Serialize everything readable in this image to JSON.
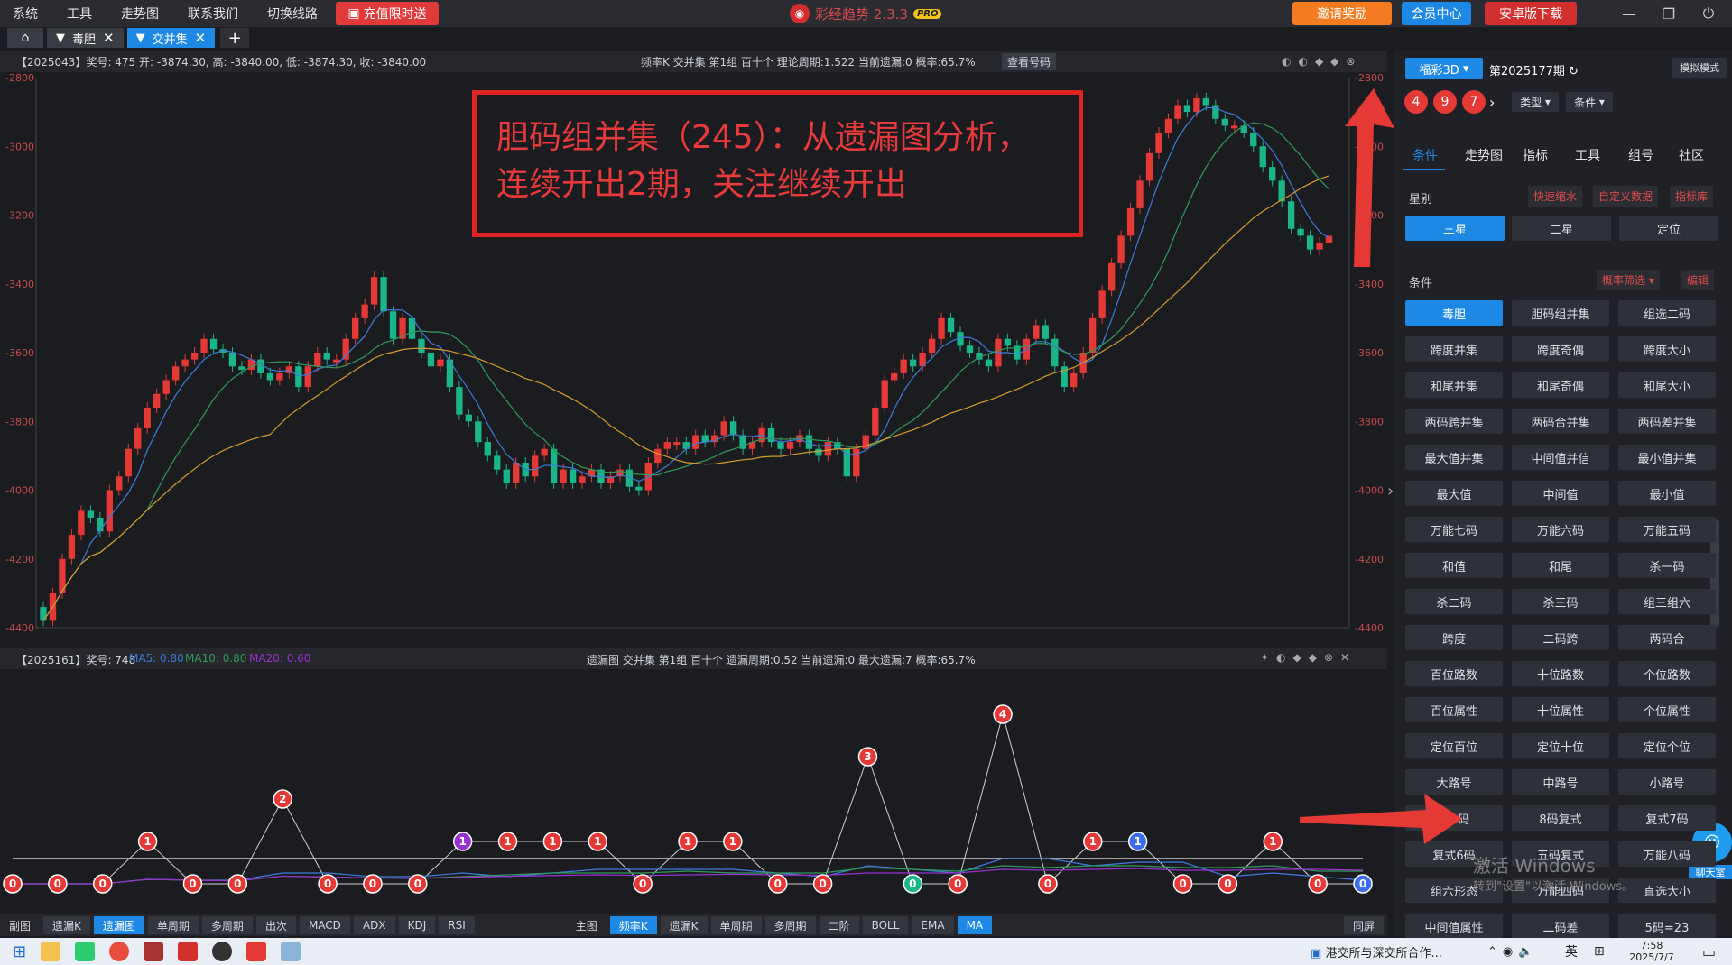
{
  "menubar": {
    "items": [
      "系统",
      "工具",
      "走势图",
      "联系我们",
      "切换线路"
    ],
    "promo": "充值限时送",
    "app_title": "彩经趋势 2.3.3",
    "pro_badge": "PRO",
    "invite": "邀请奖励",
    "member": "会员中心",
    "android": "安卓版下载"
  },
  "tabs": {
    "items": [
      {
        "label": "毒胆",
        "active": false
      },
      {
        "label": "交并集",
        "active": true
      }
    ]
  },
  "main_chart": {
    "info_left": "【2025043】奖号: 475  开: -3874.30, 高: -3840.00, 低: -3874.30, 收: -3840.00",
    "info_center": "频率K  交并集  第1组  百十个  理论周期:1.522  当前遗漏:0  概率:65.7%",
    "view_button": "查看号码",
    "y_ticks": [
      "-2800",
      "-3000",
      "-3200",
      "-3400",
      "-3600",
      "-3800",
      "-4000",
      "-4200",
      "-4400"
    ]
  },
  "sub_chart": {
    "info_left": "【2025161】奖号: 748",
    "ma5": "MA5: 0.80",
    "ma10": "MA10: 0.80",
    "ma20": "MA20: 0.60",
    "info_center": "遗漏图  交并集  第1组  百十个  遗漏周期:0.52  当前遗漏:0  最大遗漏:7  概率:65.7%"
  },
  "annotation": {
    "line1": "胆码组并集（245）：从遗漏图分析，",
    "line2": "连续开出2期，关注继续开出"
  },
  "bottombar": {
    "left": [
      "副图",
      "遗漏K",
      "遗漏图",
      "单周期",
      "多周期",
      "出次",
      "MACD",
      "ADX",
      "KDJ",
      "RSI"
    ],
    "center": [
      "主图",
      "频率K",
      "遗漏K",
      "单周期",
      "多周期",
      "二阶",
      "BOLL",
      "EMA",
      "MA"
    ],
    "right": "同屏"
  },
  "right_panel": {
    "lottery": "福彩3D",
    "period": "第2025177期",
    "mode": "模拟模式",
    "balls": [
      "4",
      "9",
      "7"
    ],
    "type_select": "类型",
    "cond_select": "条件",
    "tabs": [
      "条件",
      "走势图",
      "指标",
      "工具",
      "组号",
      "社区"
    ],
    "star_label": "星别",
    "quick_shrink": "快速缩水",
    "custom_data": "自定义数据",
    "indicator_lib": "指标库",
    "stars": [
      "三星",
      "二星",
      "定位"
    ],
    "cond_label": "条件",
    "prob_filter": "概率筛选",
    "edit": "编辑",
    "conditions": [
      "毒胆",
      "胆码组并集",
      "组选二码",
      "跨度并集",
      "跨度奇偶",
      "跨度大小",
      "和尾并集",
      "和尾奇偶",
      "和尾大小",
      "两码跨并集",
      "两码合并集",
      "两码差并集",
      "最大值并集",
      "中间值并信",
      "最小值并集",
      "最大值",
      "中间值",
      "最小值",
      "万能七码",
      "万能六码",
      "万能五码",
      "和值",
      "和尾",
      "杀一码",
      "杀二码",
      "杀三码",
      "组三组六",
      "跨度",
      "二码跨",
      "两码合",
      "百位路数",
      "十位路数",
      "个位路数",
      "百位属性",
      "十位属性",
      "个位属性",
      "定位百位",
      "定位十位",
      "定位个位",
      "大路号",
      "中路号",
      "小路号",
      "杀4码",
      "8码复式",
      "复式7码",
      "复式6码",
      "五码复式",
      "万能八码",
      "组六形态",
      "万能四码",
      "直选大小",
      "中间值属性",
      "二码差",
      "5码=23"
    ],
    "chat": "聊天室"
  },
  "watermark": {
    "line1": "激活 Windows",
    "line2": "转到\"设置\"以激活 Windows。"
  },
  "taskbar": {
    "news": "港交所与深交所合作...",
    "lang": "英",
    "time": "7:58",
    "date": "2025/7/7"
  },
  "chart_data": {
    "type": "line",
    "title": "",
    "xlabel": "",
    "ylabel": "",
    "ylim_main": [
      -4400,
      -2800
    ],
    "main_close_series": [
      -4380,
      -4300,
      -4200,
      -4130,
      -4060,
      -4080,
      -4120,
      -4000,
      -3960,
      -3880,
      -3820,
      -3760,
      -3720,
      -3680,
      -3640,
      -3620,
      -3600,
      -3560,
      -3590,
      -3600,
      -3640,
      -3650,
      -3620,
      -3660,
      -3680,
      -3660,
      -3640,
      -3700,
      -3640,
      -3600,
      -3620,
      -3620,
      -3560,
      -3500,
      -3460,
      -3380,
      -3480,
      -3560,
      -3500,
      -3560,
      -3600,
      -3640,
      -3620,
      -3700,
      -3780,
      -3800,
      -3860,
      -3900,
      -3940,
      -3980,
      -3920,
      -3960,
      -3900,
      -3880,
      -3980,
      -3940,
      -3980,
      -3960,
      -3940,
      -3980,
      -3960,
      -3940,
      -3990,
      -4000,
      -3920,
      -3880,
      -3860,
      -3860,
      -3880,
      -3840,
      -3860,
      -3840,
      -3800,
      -3840,
      -3880,
      -3860,
      -3820,
      -3860,
      -3880,
      -3860,
      -3840,
      -3880,
      -3900,
      -3860,
      -3880,
      -3960,
      -3880,
      -3840,
      -3760,
      -3680,
      -3660,
      -3620,
      -3640,
      -3600,
      -3560,
      -3500,
      -3540,
      -3580,
      -3600,
      -3620,
      -3640,
      -3560,
      -3580,
      -3620,
      -3560,
      -3520,
      -3560,
      -3640,
      -3700,
      -3660,
      -3600,
      -3500,
      -3420,
      -3340,
      -3260,
      -3180,
      -3100,
      -3020,
      -2960,
      -2920,
      -2880,
      -2900,
      -2860,
      -2880,
      -2920,
      -2940,
      -2940,
      -2960,
      -3000,
      -3060,
      -3100,
      -3160,
      -3240,
      -3260,
      -3300,
      -3280,
      -3260
    ],
    "sub_omission_series": [
      0,
      0,
      0,
      1,
      0,
      0,
      2,
      0,
      0,
      0,
      1,
      1,
      1,
      1,
      0,
      1,
      1,
      0,
      0,
      3,
      0,
      0,
      4,
      0,
      1,
      1,
      0,
      0,
      1,
      0,
      0
    ],
    "sub_ylim": [
      0,
      7
    ]
  }
}
